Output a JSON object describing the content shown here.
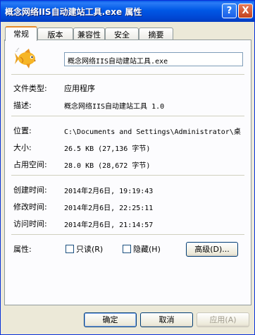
{
  "window": {
    "title": "概念网络IIS自动建站工具.exe 属性",
    "help_glyph": "?",
    "close_glyph": "X"
  },
  "tabs": [
    {
      "label": "常规"
    },
    {
      "label": "版本"
    },
    {
      "label": "兼容性"
    },
    {
      "label": "安全"
    },
    {
      "label": "摘要"
    }
  ],
  "general": {
    "file_name": "概念网络IIS自动建站工具.exe",
    "type_label": "文件类型:",
    "type_value": "应用程序",
    "desc_label": "描述:",
    "desc_value": "概念网络IIS自动建站工具 1.0",
    "location_label": "位置:",
    "location_value": "C:\\Documents and Settings\\Administrator\\桌",
    "size_label": "大小:",
    "size_value": "26.5 KB (27,136 字节)",
    "disk_label": "占用空间:",
    "disk_value": "28.0 KB (28,672 字节)",
    "created_label": "创建时间:",
    "created_value": "2014年2月6日, 19:19:43",
    "modified_label": "修改时间:",
    "modified_value": "2014年2月6日, 22:25:11",
    "accessed_label": "访问时间:",
    "accessed_value": "2014年2月6日, 21:14:57",
    "attr_label": "属性:",
    "readonly_label": "只读(R)",
    "hidden_label": "隐藏(H)",
    "advanced_label": "高级(D)..."
  },
  "buttons": {
    "ok": "确定",
    "cancel": "取消",
    "apply": "应用(A)"
  },
  "colors": {
    "title_bar": "#0058e6",
    "tab_highlight": "#e68b2c",
    "dialog_bg": "#ece9d8"
  },
  "icons": {
    "app_icon": "goldfish-icon"
  }
}
